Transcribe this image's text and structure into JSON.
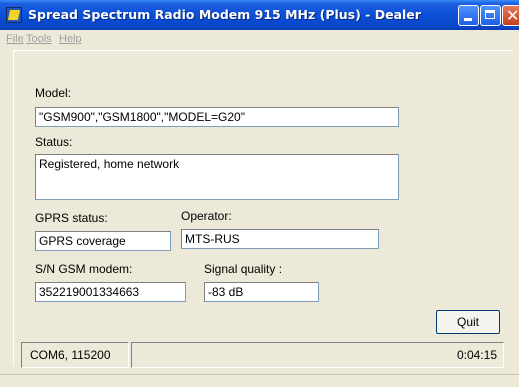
{
  "window": {
    "title": "Spread Spectrum Radio Modem 915 MHz (Plus)  - Dealer",
    "close_glyph": "✕"
  },
  "menu": {
    "items": [
      {
        "label": "File",
        "enabled": false
      },
      {
        "label": "Tools",
        "enabled": false
      },
      {
        "label": "Help",
        "enabled": false
      }
    ]
  },
  "form": {
    "model_label": "Model:",
    "model_value": " \"GSM900\",\"GSM1800\",\"MODEL=G20\"",
    "status_label": "Status:",
    "status_value": "Registered, home network",
    "gprs_status_label": "GPRS status:",
    "gprs_status_value": "GPRS coverage",
    "operator_label": "Operator:",
    "operator_value": "MTS-RUS",
    "sn_label": "S/N GSM modem:",
    "sn_value": "352219001334663",
    "signal_label": "Signal quality :",
    "signal_value": "-83 dB"
  },
  "buttons": {
    "quit_label": "Quit"
  },
  "statusbar": {
    "port": "COM6, 115200",
    "time": "0:04:15"
  },
  "colors": {
    "titlebar_blue": "#0b4fd8",
    "window_bg": "#ece9d8",
    "field_border": "#7f9db9"
  }
}
